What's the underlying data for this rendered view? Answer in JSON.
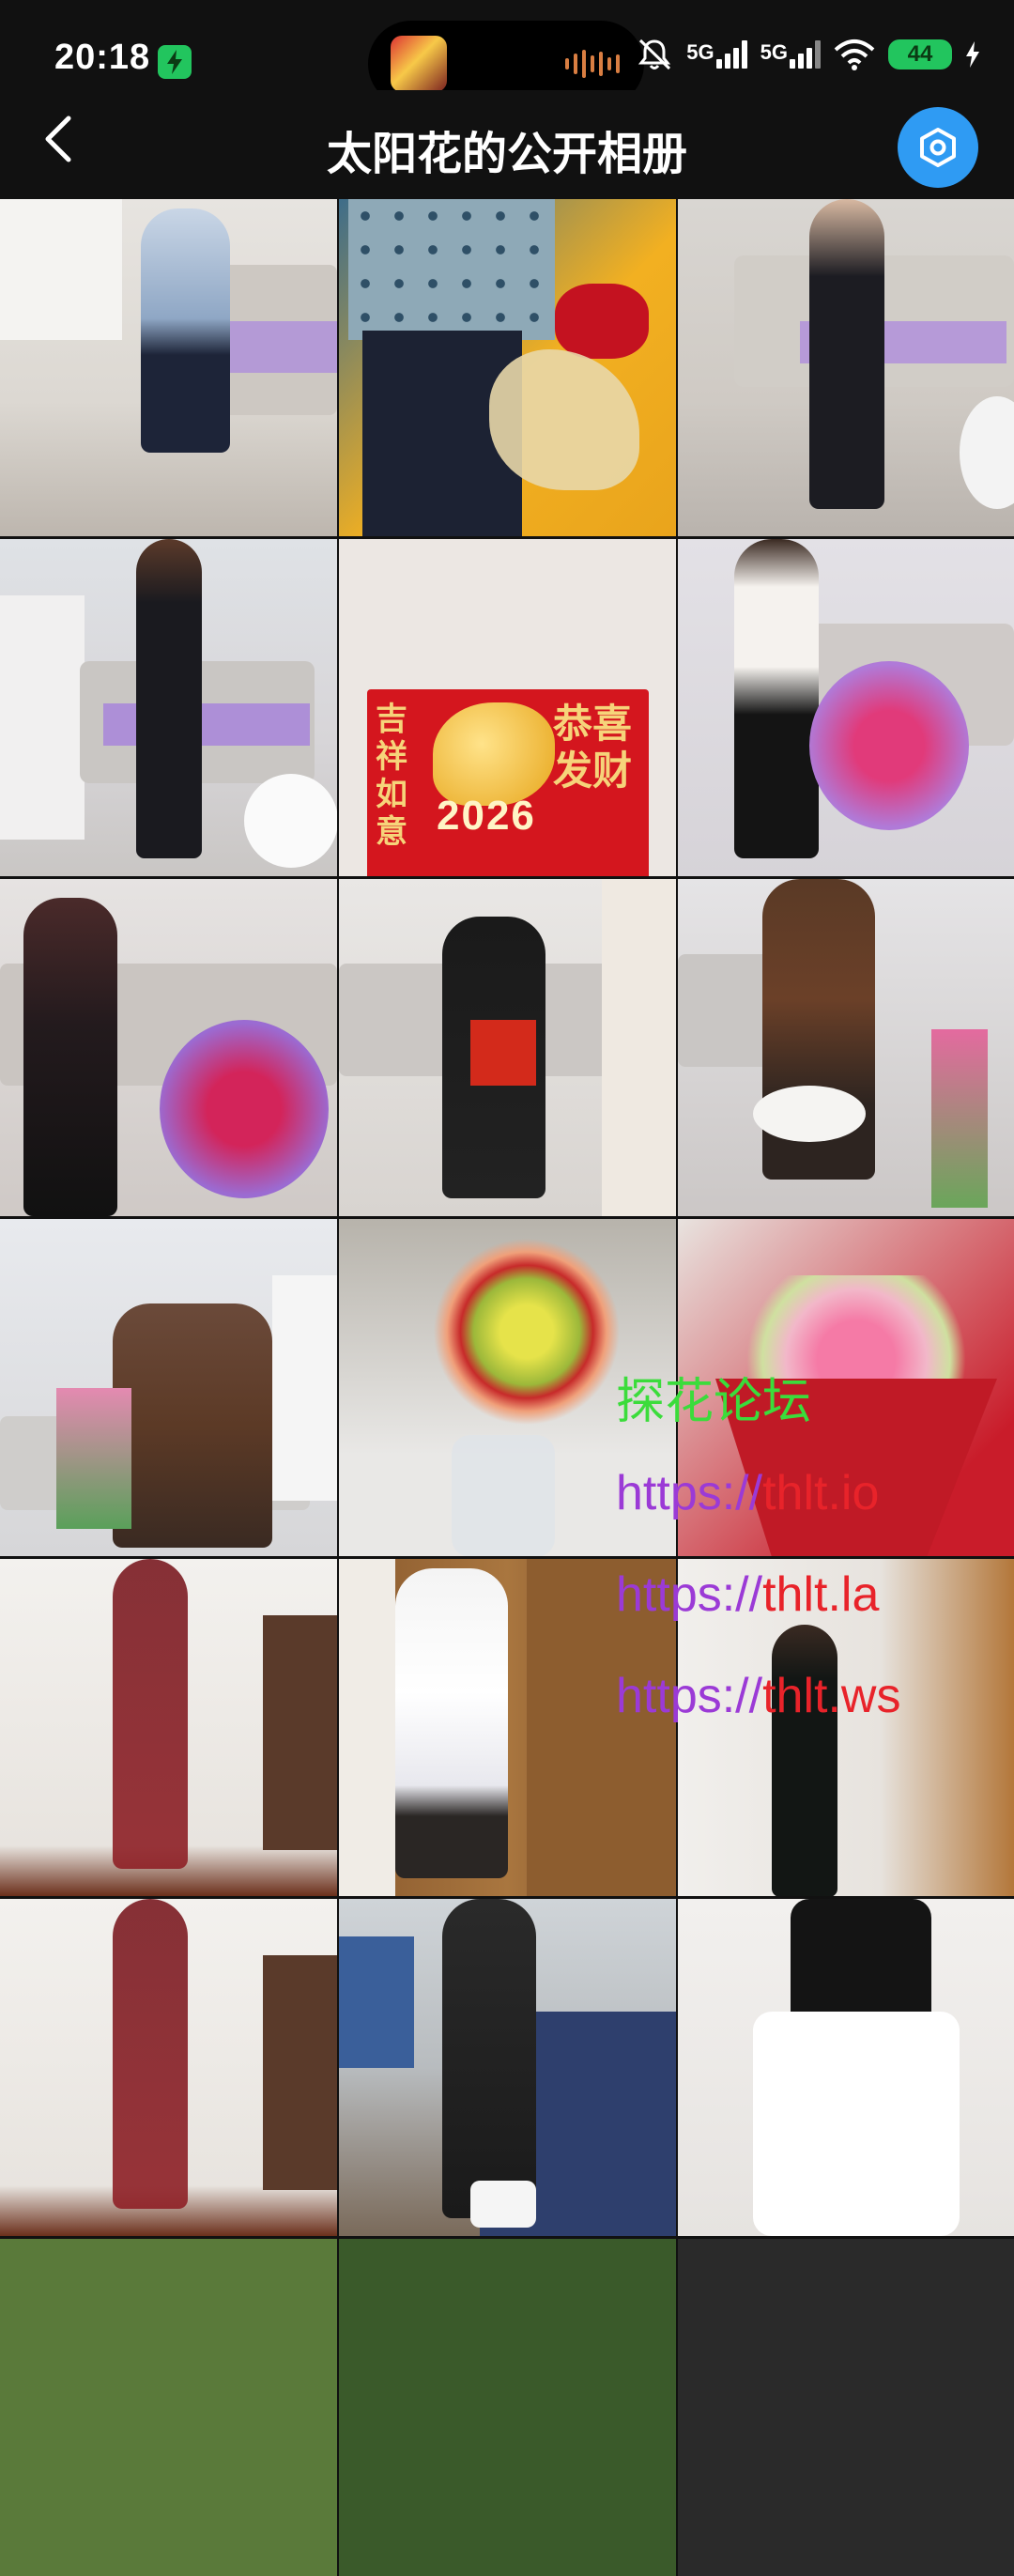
{
  "status_bar": {
    "time": "20:18",
    "network_1": "5G",
    "network_2": "5G",
    "battery": "44"
  },
  "header": {
    "title": "太阳花的公开相册"
  },
  "card": {
    "left_text": "吉祥如意",
    "right_text": "恭喜发财",
    "year": "2026"
  },
  "watermark": {
    "line1": "探花论坛",
    "line2_a": "https://",
    "line2_b": "thlt.io",
    "line3_a": "https://",
    "line3_b": "thlt.la",
    "line4_a": "https://",
    "line4_b": "thlt.ws"
  },
  "colors": {
    "background": "#111111",
    "fab": "#2f9bf3",
    "battery": "#22c55e",
    "watermark_green": "#3bdc3b",
    "watermark_purple": "#9b3ad6",
    "watermark_red": "#e8232a"
  },
  "icons": [
    "back-arrow-icon",
    "settings-hexagon-icon",
    "charging-icon",
    "mute-bell-icon",
    "signal-icon",
    "wifi-icon"
  ]
}
